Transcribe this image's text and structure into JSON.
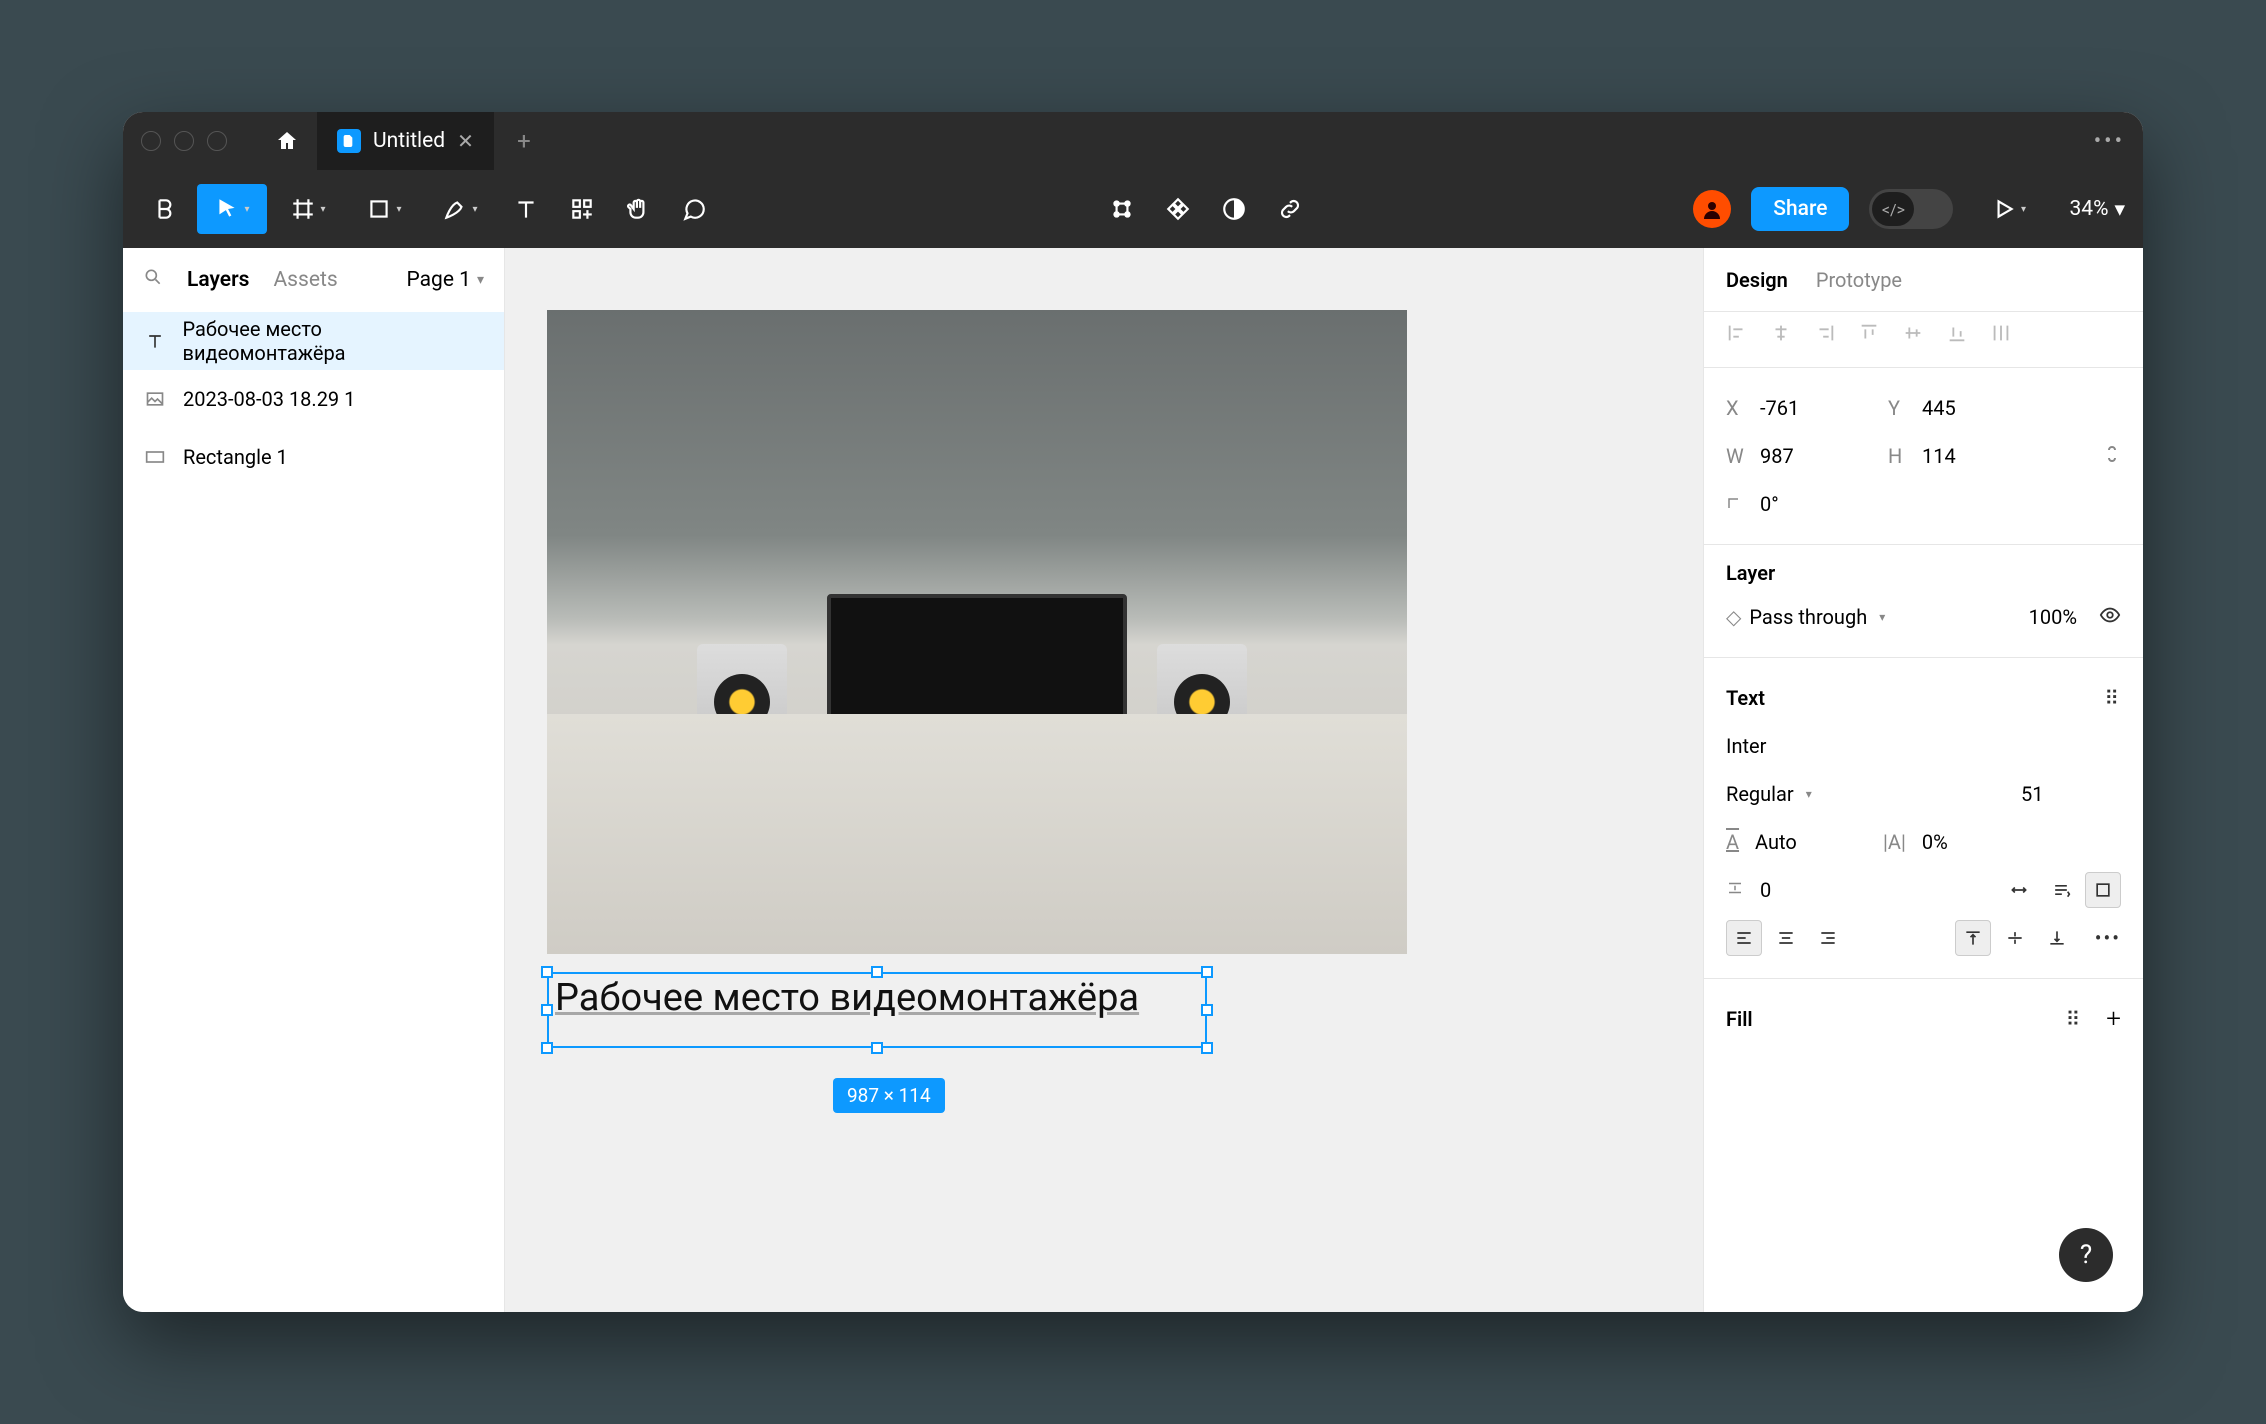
{
  "tab": {
    "title": "Untitled"
  },
  "toolbar": {
    "share": "Share",
    "zoom": "34%"
  },
  "left": {
    "layers": "Layers",
    "assets": "Assets",
    "page": "Page 1",
    "items": [
      {
        "type": "text",
        "label": "Рабочее место видеомонтажёра"
      },
      {
        "type": "image",
        "label": "2023-08-03 18.29 1"
      },
      {
        "type": "rect",
        "label": "Rectangle 1"
      }
    ]
  },
  "canvas": {
    "text_content": "Рабочее место видеомонтажёра",
    "dims": "987 × 114"
  },
  "right": {
    "tabs": {
      "design": "Design",
      "proto": "Prototype"
    },
    "x": "-761",
    "y": "445",
    "w": "987",
    "h": "114",
    "rot": "0°",
    "layer_title": "Layer",
    "blend": "Pass through",
    "opacity": "100%",
    "text_title": "Text",
    "font": "Inter",
    "weight": "Regular",
    "size": "51",
    "line_height": "Auto",
    "letter_spacing": "0%",
    "para_spacing": "0",
    "fill_title": "Fill"
  }
}
